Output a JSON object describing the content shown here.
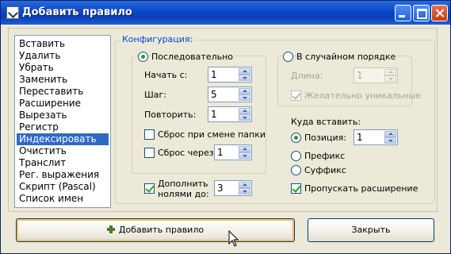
{
  "window": {
    "title": "Добавить правило"
  },
  "rules_list": {
    "items": [
      "Вставить",
      "Удалить",
      "Убрать",
      "Заменить",
      "Переставить",
      "Расширение",
      "Вырезать",
      "Регистр",
      "Индексировать",
      "Очистить",
      "Транслит",
      "Рег. выражения",
      "Скрипт (Pascal)",
      "Список имен"
    ],
    "selected": "Индексировать"
  },
  "config": {
    "caption": "Конфигурация:",
    "sequential": {
      "label": "Последовательно",
      "selected": true,
      "start_label": "Начать с:",
      "start_value": "1",
      "step_label": "Шаг:",
      "step_value": "5",
      "repeat_label": "Повторить:",
      "repeat_value": "1",
      "reset_on_folder_label": "Сброс при смене папки",
      "reset_on_folder_checked": false,
      "reset_every_label": "Сброс через:",
      "reset_every_checked": false,
      "reset_every_value": "1"
    },
    "random": {
      "label": "В случайном порядке",
      "selected": false,
      "length_label": "Длина:",
      "length_value": "1",
      "unique_label": "Желательно уникальные",
      "unique_checked": true
    },
    "pad": {
      "label_line1": "Дополнить",
      "label_line2": "нолями до:",
      "checked": true,
      "value": "3"
    },
    "insert": {
      "caption": "Куда вставить:",
      "position_label": "Позиция:",
      "position_value": "1",
      "prefix_label": "Префикс",
      "suffix_label": "Суффикс",
      "selected": "Позиция:",
      "skip_ext_label": "Пропускать расширение",
      "skip_ext_checked": true
    }
  },
  "buttons": {
    "add_label": "Добавить правило",
    "close_label": "Закрыть"
  }
}
